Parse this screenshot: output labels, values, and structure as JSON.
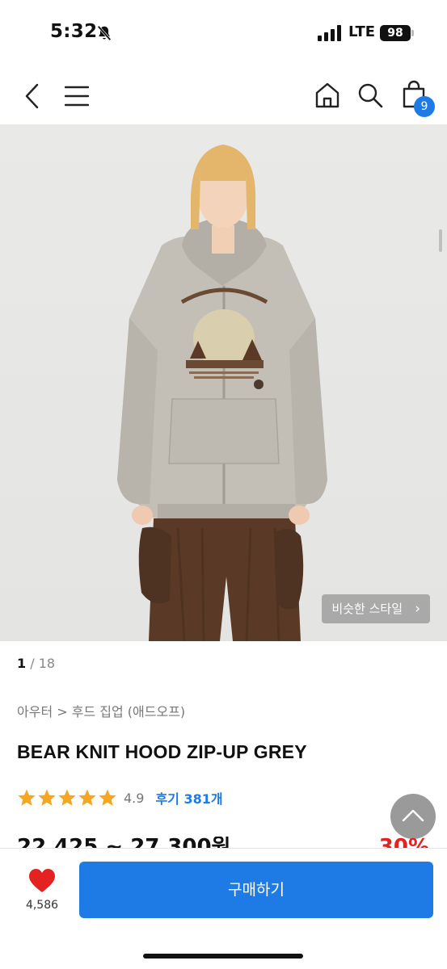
{
  "status_bar": {
    "time": "5:32",
    "network": "LTE",
    "battery": "98",
    "icons": [
      "bell-slash-icon",
      "signal-icon",
      "battery-icon"
    ]
  },
  "nav": {
    "icons": [
      "back-chevron-icon",
      "menu-icon",
      "home-icon",
      "search-icon",
      "cart-icon"
    ],
    "cart_count": "9"
  },
  "hero": {
    "similar_style_label": "비슷한 스타일",
    "image_index": "1",
    "image_separator": "/",
    "image_total": "18"
  },
  "product": {
    "breadcrumb": "아우터 > 후드 집업 (애드오프)",
    "title": "BEAR KNIT HOOD ZIP-UP GREY",
    "rating": 4.9,
    "rating_text": "4.9",
    "review_label": "후기 381개",
    "price_peek": "22,425 ~ 27,300원",
    "discount_peek": "30%"
  },
  "bottom_bar": {
    "like_count": "4,586",
    "buy_label": "구매하기"
  },
  "colors": {
    "accent": "#1e7be6",
    "star": "#f5a623",
    "heart": "#e52222",
    "discount": "#e52222"
  }
}
